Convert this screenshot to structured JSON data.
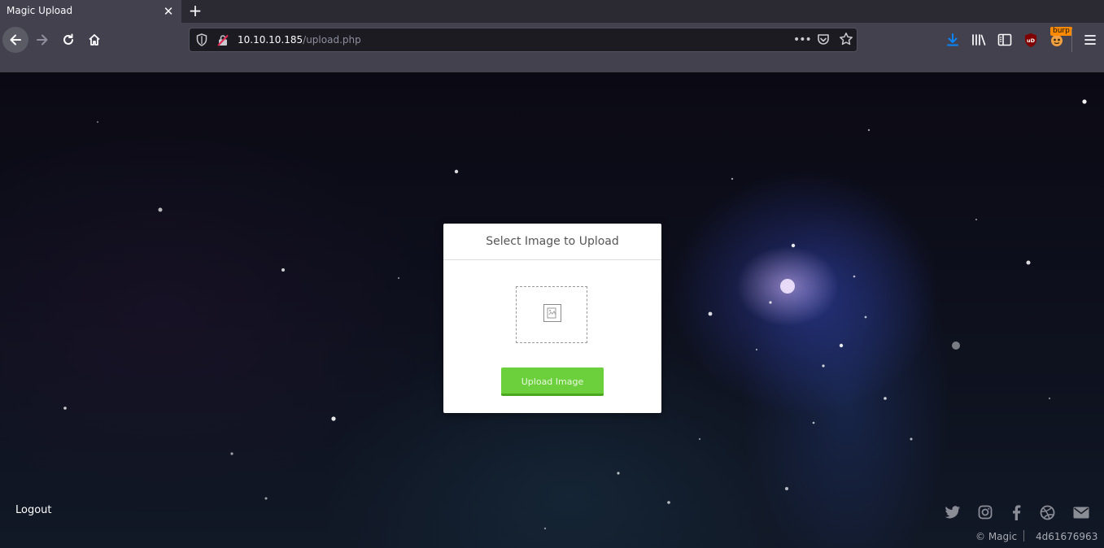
{
  "browser": {
    "tab_title": "Magic Upload",
    "close_glyph": "✕",
    "new_tab_glyph": "+",
    "url_host": "10.10.10.185",
    "url_path": "/upload.php",
    "url_more_glyph": "•••",
    "burp_badge": "burp",
    "icons": [
      "back-icon",
      "forward-icon",
      "reload-icon",
      "home-icon",
      "tracking-shield-icon",
      "insecure-lock-icon",
      "page-actions-icon",
      "pocket-icon",
      "bookmark-star-icon",
      "download-icon",
      "library-icon",
      "sidebar-icon",
      "ublock-icon",
      "burp-extension-icon",
      "hamburger-menu-icon"
    ],
    "accent_color": "#0a84ff"
  },
  "upload_card": {
    "title": "Select Image to Upload",
    "button_label": "Upload Image",
    "button_color": "#6ccf3c"
  },
  "page": {
    "logout_label": "Logout",
    "social_icons": [
      "twitter-icon",
      "instagram-icon",
      "facebook-icon",
      "dribbble-icon",
      "mail-icon"
    ],
    "copyright": "© Magic",
    "build_id": "4d61676963"
  }
}
